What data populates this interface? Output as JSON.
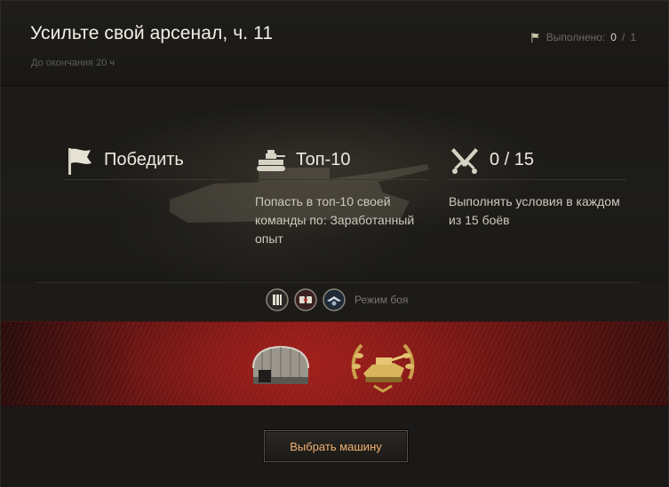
{
  "header": {
    "title": "Усильте свой арсенал, ч. 11",
    "subtitle": "До окончания 20 ч",
    "progress_label": "Выполнено:",
    "progress_done": "0",
    "progress_sep": "/",
    "progress_total": "1"
  },
  "conditions": [
    {
      "icon": "flag-icon",
      "title": "Победить",
      "description": ""
    },
    {
      "icon": "tank-top-icon",
      "title": "Топ-10",
      "description": "Попасть в топ-10 своей команды по: Заработанный опыт"
    },
    {
      "icon": "crossed-swords-icon",
      "title": "0 / 15",
      "description": "Выполнять условия в каждом из 15 боёв"
    }
  ],
  "modes": {
    "icons": [
      "random-battle-icon",
      "grand-battle-icon",
      "ranked-battle-icon"
    ],
    "label": "Режим боя"
  },
  "rewards": [
    {
      "icon": "hangar-slot-icon"
    },
    {
      "icon": "tank-medal-icon"
    }
  ],
  "footer": {
    "button_label": "Выбрать машину"
  },
  "colors": {
    "accent_button_text": "#f0b070",
    "reward_band": "#8a1a17"
  }
}
